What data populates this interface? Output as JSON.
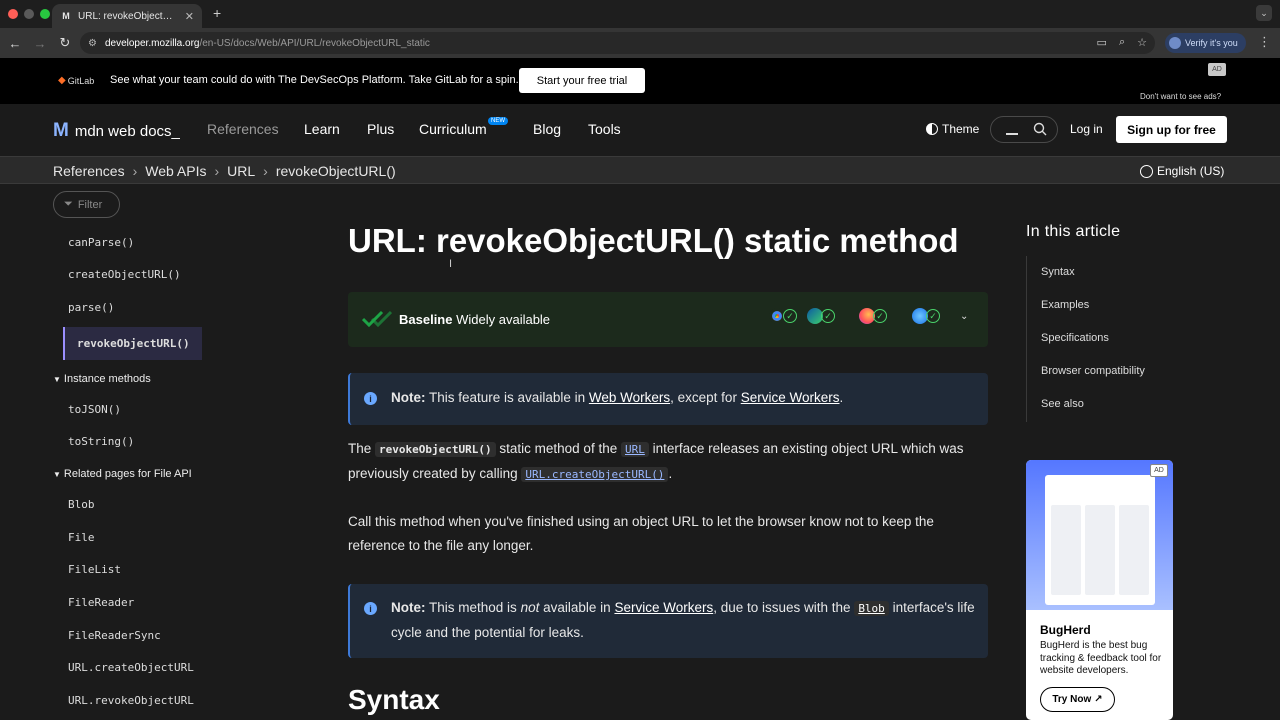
{
  "browser": {
    "tab_title": "URL: revokeObjectURL() static",
    "url_domain": "developer.mozilla.org",
    "url_path": "/en-US/docs/Web/API/URL/revokeObjectURL_static",
    "verify_label": "Verify it's you"
  },
  "ad_banner": {
    "brand": "GitLab",
    "text": "See what your team could do with The DevSecOps Platform. Take GitLab for a spin.",
    "cta": "Start your free trial",
    "ad_tag": "AD",
    "no_ads": "Don't want to see ads?"
  },
  "header": {
    "logo": "mdn web docs_",
    "nav": [
      "References",
      "Learn",
      "Plus",
      "Curriculum",
      "Blog",
      "Tools"
    ],
    "new_badge": "NEW",
    "theme": "Theme",
    "login": "Log in",
    "signup": "Sign up for free"
  },
  "breadcrumb": {
    "items": [
      "References",
      "Web APIs",
      "URL",
      "revokeObjectURL()"
    ],
    "language": "English (US)"
  },
  "sidebar": {
    "filter_placeholder": "Filter",
    "items": [
      {
        "label": "canParse()"
      },
      {
        "label": "createObjectURL()"
      },
      {
        "label": "parse()"
      },
      {
        "label": "revokeObjectURL()"
      },
      {
        "label": "Instance methods"
      },
      {
        "label": "toJSON()"
      },
      {
        "label": "toString()"
      },
      {
        "label": "Related pages for File API"
      },
      {
        "label": "Blob"
      },
      {
        "label": "File"
      },
      {
        "label": "FileList"
      },
      {
        "label": "FileReader"
      },
      {
        "label": "FileReaderSync"
      },
      {
        "label": "URL.createObjectURL"
      },
      {
        "label": "URL.revokeObjectURL"
      }
    ]
  },
  "main": {
    "title": "URL: revokeObjectURL() static method",
    "baseline_bold": "Baseline",
    "baseline_text": "Widely available",
    "note1": {
      "label": "Note:",
      "text1": "This feature is available in",
      "link1": "Web Workers",
      "text2": ", except for",
      "link2": "Service Workers",
      "text3": "."
    },
    "para1": {
      "t1": "The",
      "code1": "revokeObjectURL()",
      "t2": "static method of the",
      "code2": "URL",
      "t3": "interface releases an existing object URL which was previously created by calling",
      "code3": "URL.createObjectURL()",
      "t4": "."
    },
    "para2": "Call this method when you've finished using an object URL to let the browser know not to keep the reference to the file any longer.",
    "note2": {
      "label": "Note:",
      "t1": "This method is",
      "em": "not",
      "t2": "available in",
      "link": "Service Workers",
      "t3": ", due to issues with the",
      "code": "Blob",
      "t4": "interface's life cycle and the potential for leaks."
    },
    "syntax_heading": "Syntax"
  },
  "toc": {
    "title": "In this article",
    "items": [
      "Syntax",
      "Examples",
      "Specifications",
      "Browser compatibility",
      "See also"
    ]
  },
  "side_ad": {
    "ad_tag": "AD",
    "name": "BugHerd",
    "desc": "BugHerd is the best bug tracking & feedback tool for website developers.",
    "cta": "Try Now"
  }
}
